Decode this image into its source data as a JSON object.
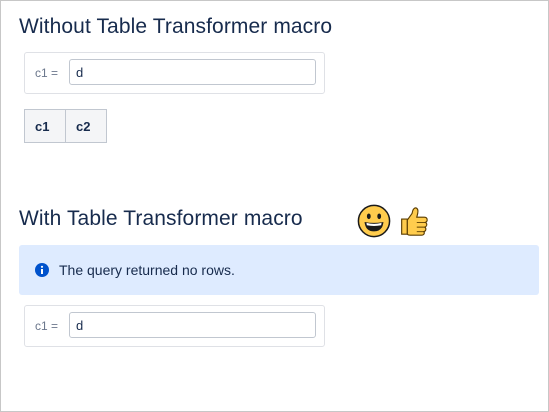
{
  "section_without": {
    "heading": "Without Table Transformer macro",
    "filter": {
      "label": "c1 =",
      "value": "d"
    },
    "table": {
      "columns": [
        "c1",
        "c2"
      ]
    }
  },
  "section_with": {
    "heading": "With Table Transformer macro",
    "emojis": [
      "grinning-face-icon",
      "thumbs-up-icon"
    ],
    "info_message": "The query returned no rows.",
    "filter": {
      "label": "c1 =",
      "value": "d"
    }
  },
  "colors": {
    "info_bg": "#deebff",
    "info_icon": "#0052cc",
    "text": "#172b4d",
    "table_header_bg": "#f4f5f7"
  }
}
